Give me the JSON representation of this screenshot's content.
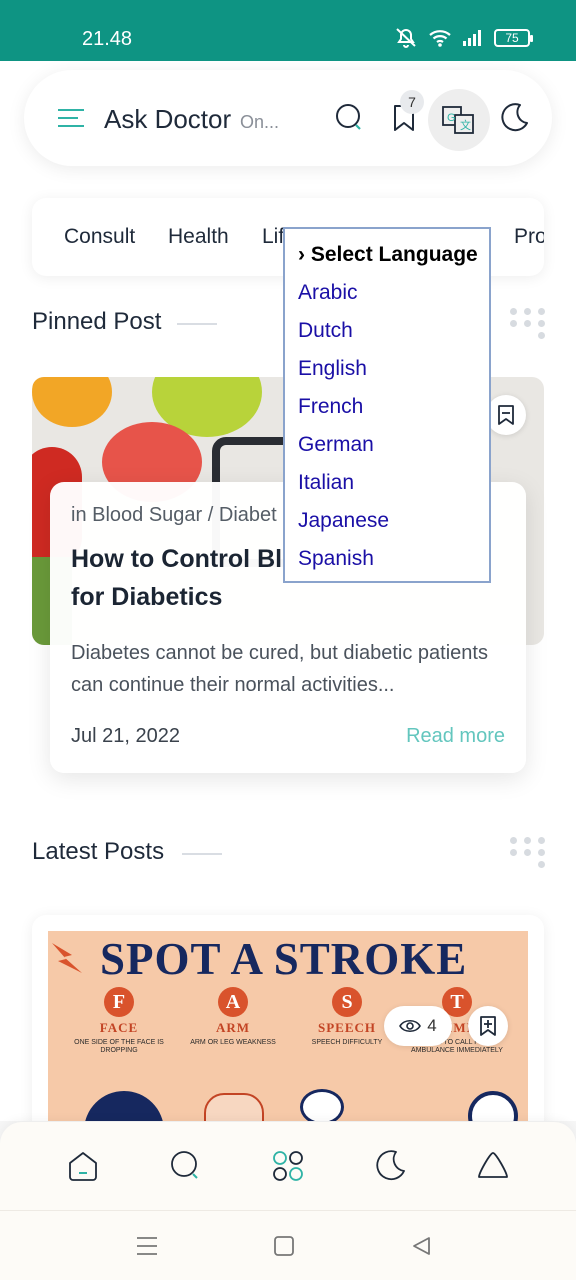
{
  "status_bar": {
    "time": "21.48",
    "battery": "75"
  },
  "header": {
    "title": "Ask Doctor",
    "subtitle": "On...",
    "bookmark_count": "7",
    "icons": [
      "menu-icon",
      "search-icon",
      "bookmark-icon",
      "translate-icon",
      "moon-icon"
    ]
  },
  "categories": [
    "Consult",
    "Health",
    "Lif",
    "Pro"
  ],
  "language_menu": {
    "heading": "› Select Language",
    "options": [
      "Arabic",
      "Dutch",
      "English",
      "French",
      "German",
      "Italian",
      "Japanese",
      "Spanish"
    ]
  },
  "pinned": {
    "section_title": "Pinned Post",
    "category": "in Blood Sugar / Diabet",
    "title": "How to Control Blood Sugar Levels for Diabetics",
    "excerpt": "Diabetes cannot be cured, but diabetic patients can continue their normal activities...",
    "date": "Jul 21, 2022",
    "read_more": "Read more"
  },
  "latest": {
    "section_title": "Latest Posts",
    "views": "4",
    "image": {
      "headline": "SPOT A STROKE",
      "columns": [
        {
          "letter": "F",
          "word": "FACE",
          "desc": "ONE SIDE OF THE FACE IS DROPPING"
        },
        {
          "letter": "A",
          "word": "ARM",
          "desc": "ARM OR LEG WEAKNESS"
        },
        {
          "letter": "S",
          "word": "SPEECH",
          "desc": "SPEECH DIFFICULTY"
        },
        {
          "letter": "T",
          "word": "TIME",
          "desc": "TIME TO CALL FOR AMBULANCE IMMEDIATELY"
        }
      ]
    }
  },
  "colors": {
    "status_bar": "#0e9483",
    "accent": "#63c6be",
    "link": "#1a0fa6"
  }
}
